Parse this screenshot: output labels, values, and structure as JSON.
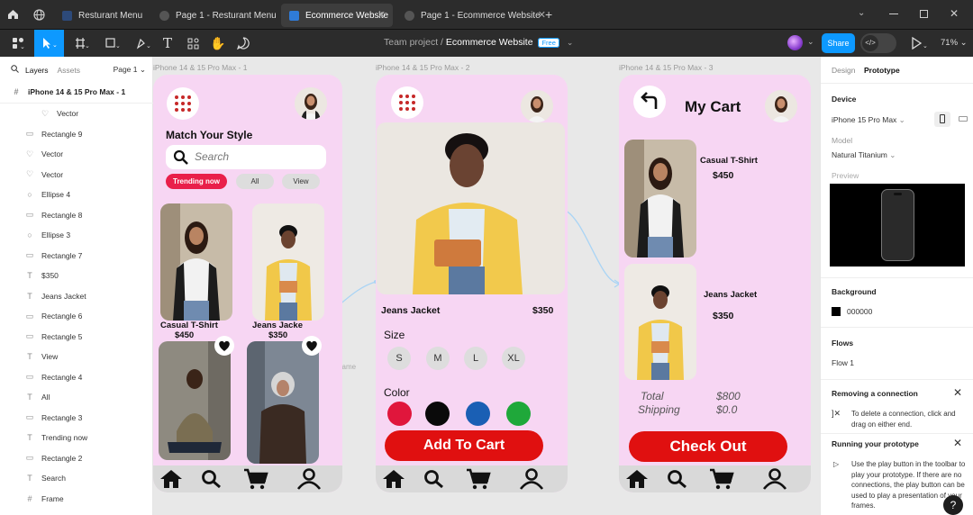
{
  "tabs": [
    {
      "label": "Resturant Menu",
      "active": false
    },
    {
      "label": "Page 1 - Resturant Menu",
      "active": false
    },
    {
      "label": "Ecommerce Website",
      "active": true
    },
    {
      "label": "Page 1 - Ecommerce Website",
      "active": false
    }
  ],
  "toolbar": {
    "project": "Team project",
    "separator": "/",
    "file": "Ecommerce Website",
    "plan_badge": "Free",
    "share": "Share",
    "zoom": "71%"
  },
  "left_panel": {
    "tab_layers": "Layers",
    "tab_assets": "Assets",
    "page": "Page 1",
    "frame_name": "iPhone 14 & 15 Pro Max - 1",
    "layers": [
      "Vector",
      "Rectangle 9",
      "Vector",
      "Vector",
      "Ellipse 4",
      "Rectangle 8",
      "Ellipse 3",
      "Rectangle 7",
      "$350",
      "Jeans Jacket",
      "Rectangle 6",
      "Rectangle 5",
      "View",
      "Rectangle 4",
      "All",
      "Rectangle 3",
      "Trending now",
      "Rectangle 2",
      "Search",
      "Frame"
    ]
  },
  "canvas": {
    "frame_labels": [
      "iPhone 14 & 15 Pro Max - 1",
      "iPhone 14 & 15 Pro Max - 2",
      "iPhone 14 & 15 Pro Max - 3"
    ],
    "frame_tag": "Frame",
    "screen1": {
      "heading": "Match Your Style",
      "search_placeholder": "Search",
      "chips": [
        "Trending now",
        "All",
        "View"
      ],
      "products": [
        {
          "name": "Casual T-Shirt",
          "price": "$450"
        },
        {
          "name": "Jeans Jacke",
          "price": "$350"
        }
      ]
    },
    "screen2": {
      "product_name": "Jeans Jacket",
      "price": "$350",
      "size_label": "Size",
      "sizes": [
        "S",
        "M",
        "L",
        "XL"
      ],
      "color_label": "Color",
      "colors": [
        "#e0163c",
        "#0a0a0a",
        "#1a5fb4",
        "#1fa83a"
      ],
      "cta": "Add To Cart"
    },
    "screen3": {
      "title": "My Cart",
      "items": [
        {
          "name": "Casual T-Shirt",
          "price": "$450"
        },
        {
          "name": "Jeans Jacket",
          "price": "$350"
        }
      ],
      "total_label": "Total",
      "total_value": "$800",
      "shipping_label": "Shipping",
      "shipping_value": "$0.0",
      "cta": "Check Out"
    },
    "nav_icons": [
      "home-icon",
      "search-icon",
      "cart-icon",
      "user-icon"
    ]
  },
  "right_panel": {
    "tab_design": "Design",
    "tab_prototype": "Prototype",
    "device_label": "Device",
    "device_value": "iPhone 15 Pro Max",
    "model_label": "Model",
    "model_value": "Natural Titanium",
    "preview_label": "Preview",
    "background_label": "Background",
    "background_value": "000000",
    "flows_label": "Flows",
    "flow_item": "Flow 1",
    "removing_title": "Removing a connection",
    "removing_text": "To delete a connection, click and drag on either end.",
    "running_title": "Running your prototype",
    "running_text": "Use the play button in the toolbar to play your prototype. If there are no connections, the play button can be used to play a presentation of your frames."
  },
  "colors": {
    "accent": "#0d99ff",
    "phone_bg": "#f7d6f3",
    "cta_red": "#e01010"
  }
}
